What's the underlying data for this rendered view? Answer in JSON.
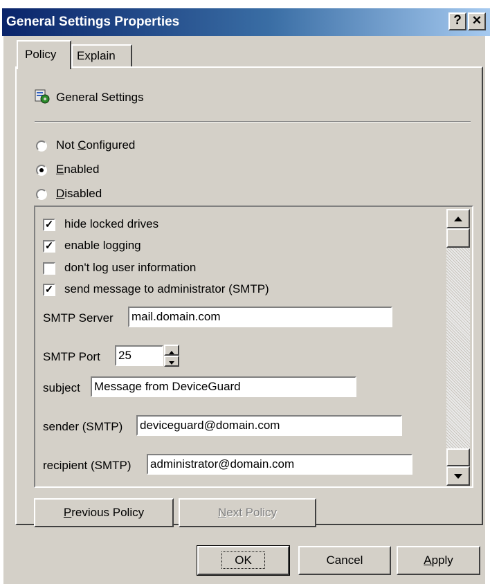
{
  "window": {
    "title": "General Settings Properties",
    "help_glyph": "?",
    "close_glyph": "✕"
  },
  "tabs": [
    {
      "label": "Policy"
    },
    {
      "label": "Explain"
    }
  ],
  "policy": {
    "name": "General Settings",
    "icon": "policy-setting-icon"
  },
  "state_options": [
    {
      "pre": "Not ",
      "accel": "C",
      "post": "onfigured",
      "selected": false
    },
    {
      "pre": "",
      "accel": "E",
      "post": "nabled",
      "selected": true
    },
    {
      "pre": "",
      "accel": "D",
      "post": "isabled",
      "selected": false
    }
  ],
  "settings": {
    "checkboxes": [
      {
        "label": "hide locked drives",
        "checked": true
      },
      {
        "label": "enable logging",
        "checked": true
      },
      {
        "label": "don't log user information",
        "checked": false
      },
      {
        "label": "send message to administrator (SMTP)",
        "checked": true
      }
    ],
    "smtp_server": {
      "label": "SMTP Server",
      "value": "mail.domain.com"
    },
    "smtp_port": {
      "label": "SMTP Port",
      "value": "25"
    },
    "subject": {
      "label": "subject",
      "value": "Message from DeviceGuard"
    },
    "sender": {
      "label": "sender (SMTP)",
      "value": "deviceguard@domain.com"
    },
    "recipient": {
      "label": "recipient (SMTP)",
      "value": "administrator@domain.com"
    }
  },
  "nav": {
    "previous": {
      "accel": "P",
      "rest": "revious Policy"
    },
    "next": {
      "accel": "N",
      "rest": "ext Policy"
    }
  },
  "buttons": {
    "ok": "OK",
    "cancel": "Cancel",
    "apply_accel": "A",
    "apply_rest": "pply"
  }
}
